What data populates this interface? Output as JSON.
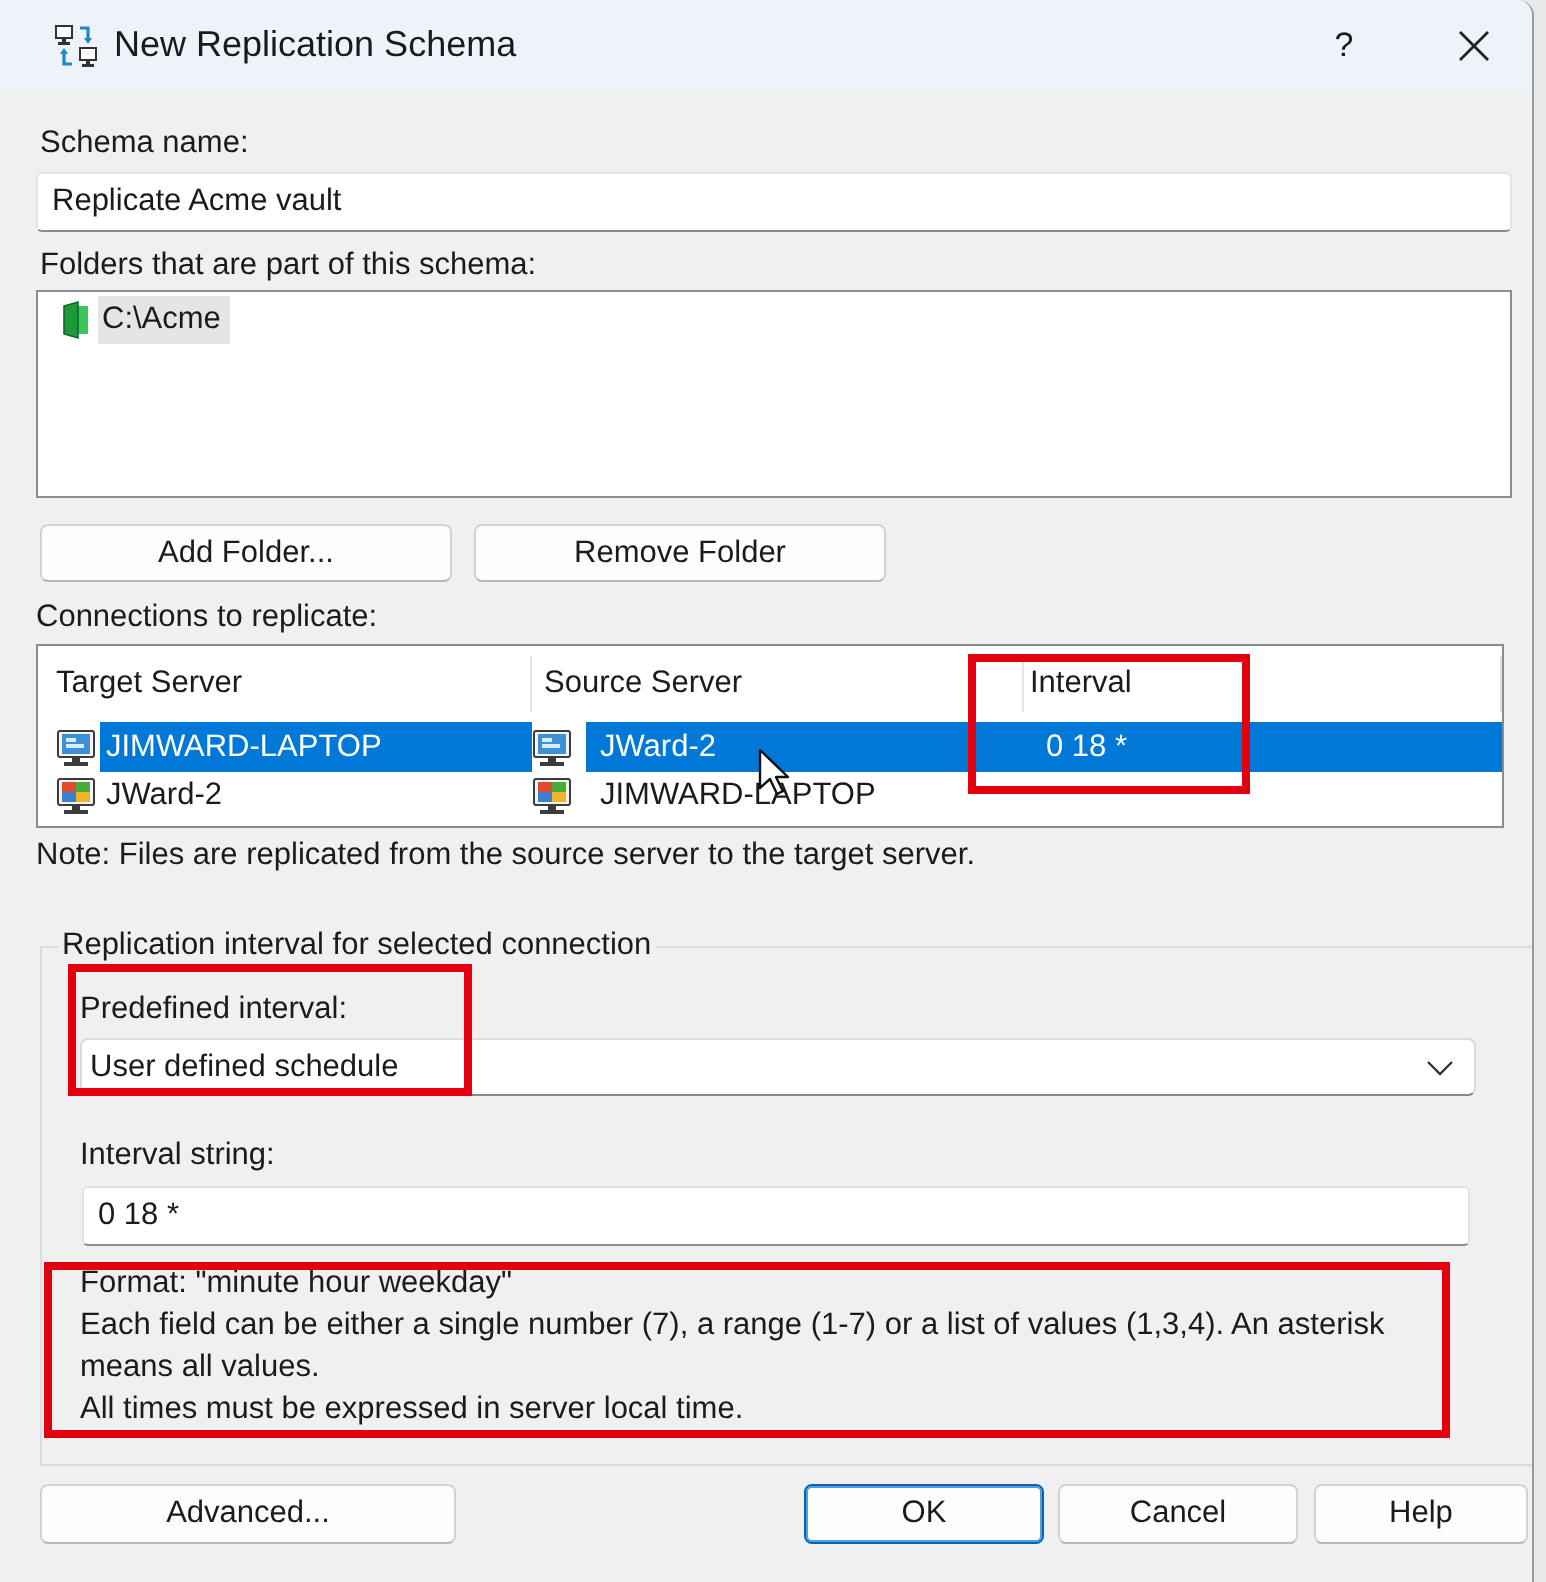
{
  "window": {
    "title": "New Replication Schema",
    "help_button": "?"
  },
  "schema_name": {
    "label": "Schema name:",
    "value": "Replicate Acme vault"
  },
  "folders": {
    "label": "Folders that are part of this schema:",
    "items": [
      {
        "path": "C:\\Acme",
        "selected": true
      }
    ],
    "buttons": [
      "Add Folder...",
      "Remove Folder"
    ]
  },
  "connections": {
    "label": "Connections to replicate:",
    "columns": [
      {
        "title": "Target Server",
        "highlighted": false
      },
      {
        "title": "Source Server",
        "highlighted": false
      },
      {
        "title": "Interval",
        "highlighted": true
      }
    ],
    "rows": [
      {
        "target": "JIMWARD-LAPTOP",
        "source": "JWard-2",
        "interval": "0 18 *",
        "selected": true
      },
      {
        "target": "JWard-2",
        "source": "JIMWARD-LAPTOP",
        "selected": false
      }
    ]
  },
  "note": "Note: Files are replicated from the source server to the target server.",
  "interval_group": {
    "title": "Replication interval for selected connection",
    "predefined_interval": {
      "label": "Predefined interval:",
      "value": "User defined schedule",
      "highlighted": true
    },
    "interval_string": {
      "label": "Interval string:",
      "value": "0 18 *"
    },
    "format_help": {
      "lines": [
        "Format: \"minute hour weekday\"",
        "Each field can be either a single number (7), a range (1-7) or a list of values (1,3,4). An asterisk means all values.",
        "All times must be expressed in server local time."
      ],
      "highlighted": true
    }
  },
  "buttons": [
    {
      "label": "Advanced...",
      "default": false
    },
    {
      "label": "OK",
      "default": true
    },
    {
      "label": "Cancel",
      "default": false
    },
    {
      "label": "Help",
      "default": false
    }
  ]
}
